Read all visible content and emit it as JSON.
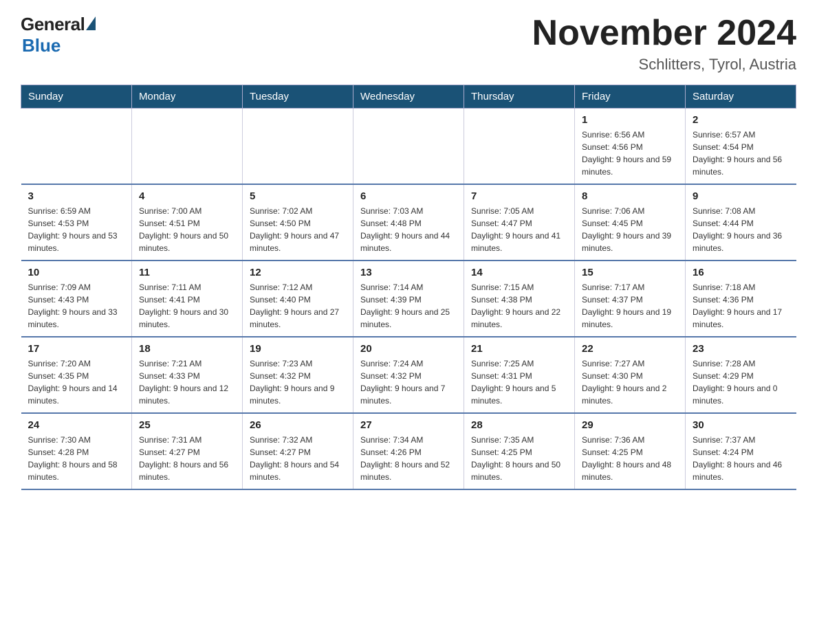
{
  "header": {
    "logo_general": "General",
    "logo_blue": "Blue",
    "month_title": "November 2024",
    "location": "Schlitters, Tyrol, Austria"
  },
  "calendar": {
    "days_of_week": [
      "Sunday",
      "Monday",
      "Tuesday",
      "Wednesday",
      "Thursday",
      "Friday",
      "Saturday"
    ],
    "weeks": [
      [
        {
          "day": "",
          "info": ""
        },
        {
          "day": "",
          "info": ""
        },
        {
          "day": "",
          "info": ""
        },
        {
          "day": "",
          "info": ""
        },
        {
          "day": "",
          "info": ""
        },
        {
          "day": "1",
          "info": "Sunrise: 6:56 AM\nSunset: 4:56 PM\nDaylight: 9 hours and 59 minutes."
        },
        {
          "day": "2",
          "info": "Sunrise: 6:57 AM\nSunset: 4:54 PM\nDaylight: 9 hours and 56 minutes."
        }
      ],
      [
        {
          "day": "3",
          "info": "Sunrise: 6:59 AM\nSunset: 4:53 PM\nDaylight: 9 hours and 53 minutes."
        },
        {
          "day": "4",
          "info": "Sunrise: 7:00 AM\nSunset: 4:51 PM\nDaylight: 9 hours and 50 minutes."
        },
        {
          "day": "5",
          "info": "Sunrise: 7:02 AM\nSunset: 4:50 PM\nDaylight: 9 hours and 47 minutes."
        },
        {
          "day": "6",
          "info": "Sunrise: 7:03 AM\nSunset: 4:48 PM\nDaylight: 9 hours and 44 minutes."
        },
        {
          "day": "7",
          "info": "Sunrise: 7:05 AM\nSunset: 4:47 PM\nDaylight: 9 hours and 41 minutes."
        },
        {
          "day": "8",
          "info": "Sunrise: 7:06 AM\nSunset: 4:45 PM\nDaylight: 9 hours and 39 minutes."
        },
        {
          "day": "9",
          "info": "Sunrise: 7:08 AM\nSunset: 4:44 PM\nDaylight: 9 hours and 36 minutes."
        }
      ],
      [
        {
          "day": "10",
          "info": "Sunrise: 7:09 AM\nSunset: 4:43 PM\nDaylight: 9 hours and 33 minutes."
        },
        {
          "day": "11",
          "info": "Sunrise: 7:11 AM\nSunset: 4:41 PM\nDaylight: 9 hours and 30 minutes."
        },
        {
          "day": "12",
          "info": "Sunrise: 7:12 AM\nSunset: 4:40 PM\nDaylight: 9 hours and 27 minutes."
        },
        {
          "day": "13",
          "info": "Sunrise: 7:14 AM\nSunset: 4:39 PM\nDaylight: 9 hours and 25 minutes."
        },
        {
          "day": "14",
          "info": "Sunrise: 7:15 AM\nSunset: 4:38 PM\nDaylight: 9 hours and 22 minutes."
        },
        {
          "day": "15",
          "info": "Sunrise: 7:17 AM\nSunset: 4:37 PM\nDaylight: 9 hours and 19 minutes."
        },
        {
          "day": "16",
          "info": "Sunrise: 7:18 AM\nSunset: 4:36 PM\nDaylight: 9 hours and 17 minutes."
        }
      ],
      [
        {
          "day": "17",
          "info": "Sunrise: 7:20 AM\nSunset: 4:35 PM\nDaylight: 9 hours and 14 minutes."
        },
        {
          "day": "18",
          "info": "Sunrise: 7:21 AM\nSunset: 4:33 PM\nDaylight: 9 hours and 12 minutes."
        },
        {
          "day": "19",
          "info": "Sunrise: 7:23 AM\nSunset: 4:32 PM\nDaylight: 9 hours and 9 minutes."
        },
        {
          "day": "20",
          "info": "Sunrise: 7:24 AM\nSunset: 4:32 PM\nDaylight: 9 hours and 7 minutes."
        },
        {
          "day": "21",
          "info": "Sunrise: 7:25 AM\nSunset: 4:31 PM\nDaylight: 9 hours and 5 minutes."
        },
        {
          "day": "22",
          "info": "Sunrise: 7:27 AM\nSunset: 4:30 PM\nDaylight: 9 hours and 2 minutes."
        },
        {
          "day": "23",
          "info": "Sunrise: 7:28 AM\nSunset: 4:29 PM\nDaylight: 9 hours and 0 minutes."
        }
      ],
      [
        {
          "day": "24",
          "info": "Sunrise: 7:30 AM\nSunset: 4:28 PM\nDaylight: 8 hours and 58 minutes."
        },
        {
          "day": "25",
          "info": "Sunrise: 7:31 AM\nSunset: 4:27 PM\nDaylight: 8 hours and 56 minutes."
        },
        {
          "day": "26",
          "info": "Sunrise: 7:32 AM\nSunset: 4:27 PM\nDaylight: 8 hours and 54 minutes."
        },
        {
          "day": "27",
          "info": "Sunrise: 7:34 AM\nSunset: 4:26 PM\nDaylight: 8 hours and 52 minutes."
        },
        {
          "day": "28",
          "info": "Sunrise: 7:35 AM\nSunset: 4:25 PM\nDaylight: 8 hours and 50 minutes."
        },
        {
          "day": "29",
          "info": "Sunrise: 7:36 AM\nSunset: 4:25 PM\nDaylight: 8 hours and 48 minutes."
        },
        {
          "day": "30",
          "info": "Sunrise: 7:37 AM\nSunset: 4:24 PM\nDaylight: 8 hours and 46 minutes."
        }
      ]
    ]
  }
}
